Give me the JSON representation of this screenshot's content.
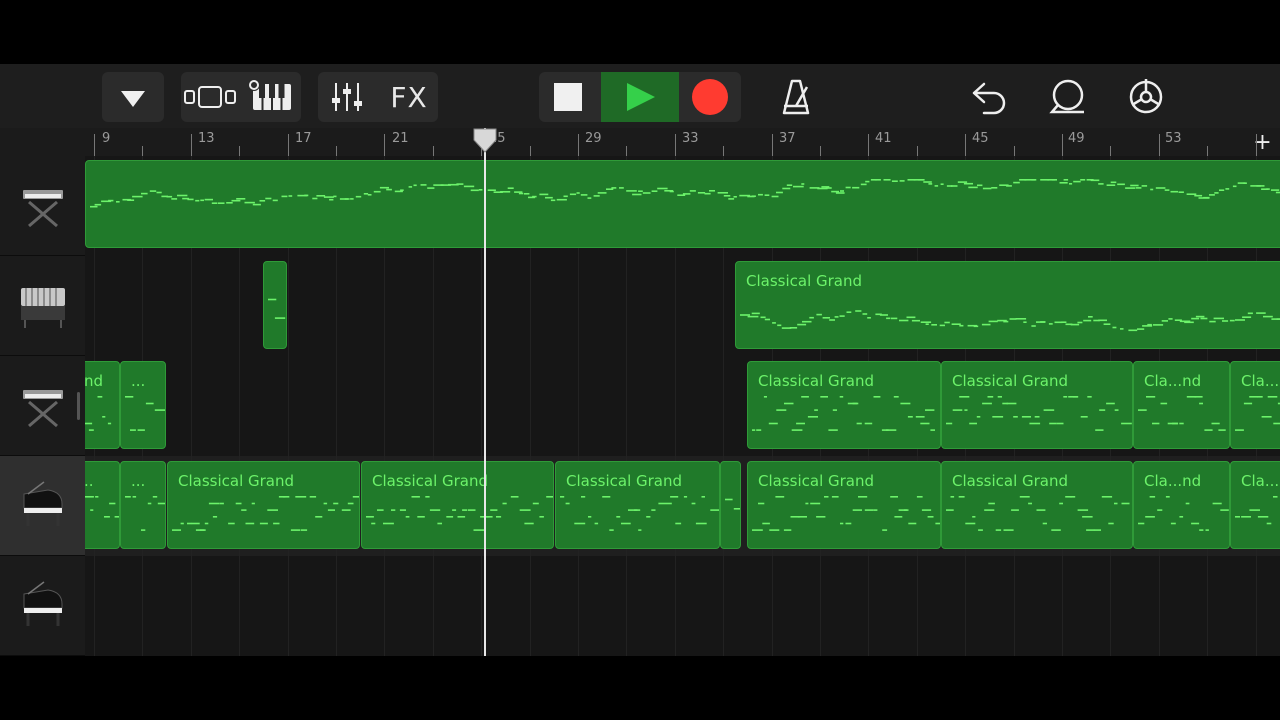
{
  "toolbar": {
    "tracks_menu_icon": "triangle-down-icon",
    "view_icon": "track-view-icon",
    "keyboard_icon": "piano-keyboard-icon",
    "mixer_icon": "mixer-sliders-icon",
    "fx_label": "FX",
    "stop_icon": "stop-icon",
    "play_icon": "play-icon",
    "record_icon": "record-icon",
    "metronome_icon": "metronome-icon",
    "undo_icon": "undo-icon",
    "loop_icon": "loop-browser-icon",
    "settings_icon": "settings-gear-icon",
    "colors": {
      "play_bg": "#1f6a26",
      "play": "#35d04a",
      "record": "#ff3b30"
    }
  },
  "ruler": {
    "bar_labels": [
      "9",
      "13",
      "17",
      "21",
      "25",
      "29",
      "33",
      "37",
      "41",
      "45",
      "49",
      "53"
    ],
    "add_label": "+"
  },
  "tracks": [
    {
      "id": "track-1",
      "instrument_icon": "keyboard-stand-icon",
      "selected": false
    },
    {
      "id": "track-2",
      "instrument_icon": "vibraphone-icon",
      "selected": false
    },
    {
      "id": "track-3",
      "instrument_icon": "keyboard-stand-icon",
      "selected": false
    },
    {
      "id": "track-4",
      "instrument_icon": "grand-piano-icon",
      "selected": true
    },
    {
      "id": "track-5",
      "instrument_icon": "grand-piano-icon",
      "selected": false
    }
  ],
  "regions": {
    "t2_r2": "Classical Grand",
    "t3_r1": "nd",
    "t3_r2": "...",
    "t3_r3": "Classical Grand",
    "t3_r4": "Classical Grand",
    "t3_r5": "Cla...nd",
    "t3_r6": "Cla...",
    "t4_r1": "..",
    "t4_r2": "...",
    "t4_r3": "Classical Grand",
    "t4_r4": "Classical Grand",
    "t4_r5": "Classical Grand",
    "t4_r7": "Classical Grand",
    "t4_r8": "Classical Grand",
    "t4_r9": "Cla...nd",
    "t4_r10": "Cla..."
  },
  "colors": {
    "region_fill": "#207a2a",
    "note": "#6cf36a"
  }
}
